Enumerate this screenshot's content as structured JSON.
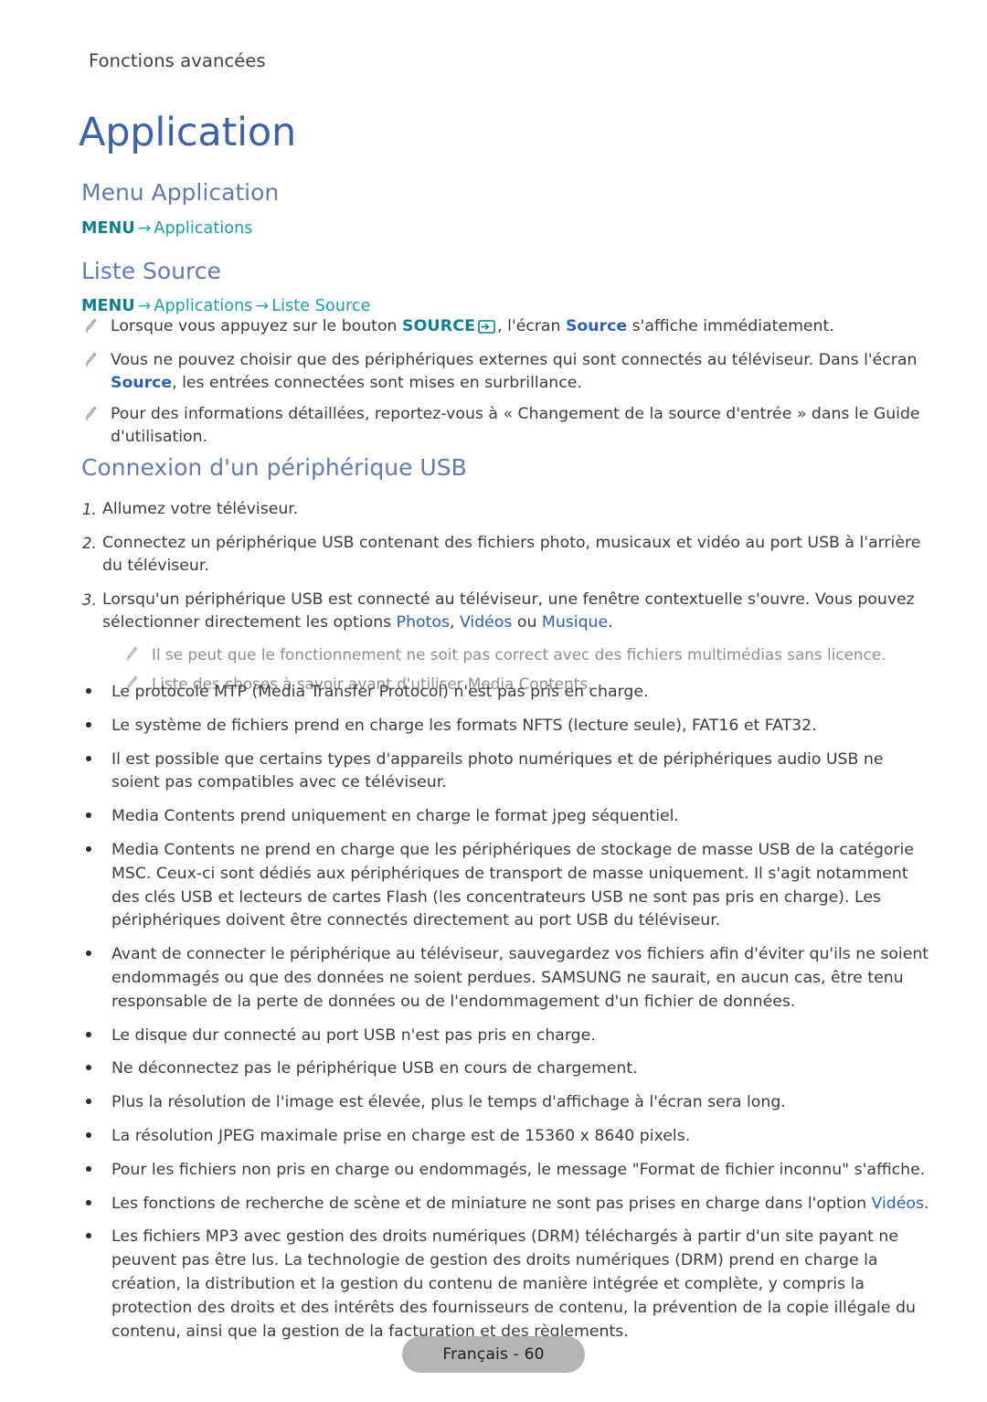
{
  "header": {
    "running_title": "Fonctions avancées"
  },
  "title": "Application",
  "sections": {
    "menu_application": {
      "heading": "Menu Application",
      "path": {
        "menu": "MENU",
        "arrow": "→",
        "item1": "Applications"
      }
    },
    "liste_source": {
      "heading": "Liste Source",
      "path": {
        "menu": "MENU",
        "arrow1": "→",
        "item1": "Applications",
        "arrow2": "→",
        "item2": "Liste Source"
      },
      "notes": [
        {
          "pre": "Lorsque vous appuyez sur le bouton ",
          "kw": "SOURCE",
          "icon": "source-button-icon",
          "mid": ", l'écran ",
          "link": "Source",
          "post": " s'affiche immédiatement."
        },
        {
          "pre": "Vous ne pouvez choisir que des périphériques externes qui sont connectés au téléviseur. Dans l'écran ",
          "link": "Source",
          "post": ", les entrées connectées sont mises en surbrillance."
        },
        {
          "pre": "Pour des informations détaillées, reportez-vous à « Changement de la source d'entrée » dans le Guide d'utilisation."
        }
      ]
    },
    "connexion_usb": {
      "heading": "Connexion d'un périphérique USB",
      "steps": [
        {
          "num": "1.",
          "text": "Allumez votre téléviseur."
        },
        {
          "num": "2.",
          "text": "Connectez un périphérique USB contenant des fichiers photo, musicaux et vidéo au port USB à l'arrière du téléviseur."
        },
        {
          "num": "3.",
          "pre": "Lorsqu'un périphérique USB est connecté au téléviseur, une fenêtre contextuelle s'ouvre. Vous pouvez sélectionner directement les options ",
          "link1": "Photos",
          "sep1": ", ",
          "link2": "Vidéos",
          "sep2": " ou ",
          "link3": "Musique",
          "post": ".",
          "subnotes": [
            "Il se peut que le fonctionnement ne soit pas correct avec des fichiers multimédias sans licence.",
            "Liste des choses à savoir avant d'utiliser Media Contents."
          ]
        }
      ],
      "bullets": [
        {
          "text": "Le protocole MTP (Media Transfer Protocol) n'est pas pris en charge."
        },
        {
          "text": "Le système de fichiers prend en charge les formats NFTS (lecture seule), FAT16 et FAT32."
        },
        {
          "text": "Il est possible que certains types d'appareils photo numériques et de périphériques audio USB ne soient pas compatibles avec ce téléviseur."
        },
        {
          "text": "Media Contents prend uniquement en charge le format jpeg séquentiel."
        },
        {
          "text": "Media Contents ne prend en charge que les périphériques de stockage de masse USB de la catégorie MSC. Ceux-ci sont dédiés aux périphériques de transport de masse uniquement. Il s'agit notamment des clés USB et lecteurs de cartes Flash (les concentrateurs USB ne sont pas pris en charge). Les périphériques doivent être connectés directement au port USB du téléviseur."
        },
        {
          "text": "Avant de connecter le périphérique au téléviseur, sauvegardez vos fichiers afin d'éviter qu'ils ne soient endommagés ou que des données ne soient perdues. SAMSUNG ne saurait, en aucun cas, être tenu responsable de la perte de données ou de l'endommagement d'un fichier de données."
        },
        {
          "text": "Le disque dur connecté au port USB n'est pas pris en charge."
        },
        {
          "text": "Ne déconnectez pas le périphérique USB en cours de chargement."
        },
        {
          "text": "Plus la résolution de l'image est élevée, plus le temps d'affichage à l'écran sera long."
        },
        {
          "text": "La résolution JPEG maximale prise en charge est de 15360 x 8640 pixels."
        },
        {
          "text": "Pour les fichiers non pris en charge ou endommagés, le message \"Format de fichier inconnu\" s'affiche."
        },
        {
          "pre": "Les fonctions de recherche de scène et de miniature ne sont pas prises en charge dans l'option ",
          "link": "Vidéos",
          "post": "."
        },
        {
          "text": "Les fichiers MP3 avec gestion des droits numériques (DRM) téléchargés à partir d'un site payant ne peuvent pas être lus. La technologie de gestion des droits numériques (DRM) prend en charge la création, la distribution et la gestion du contenu de manière intégrée et complète, y compris la protection des droits et des intérêts des fournisseurs de contenu, la prévention de la copie illégale du contenu, ainsi que la gestion de la facturation et des règlements."
        }
      ]
    }
  },
  "footer": {
    "page_label": "Français - 60"
  },
  "colors": {
    "title_blue": "#3e62a6",
    "subtitle_blue": "#6479ad",
    "menu_teal": "#0e7c8c",
    "menu_item_teal": "#2199ad",
    "link_blue": "#2f60ab",
    "body_text": "#3c3c3c",
    "dim_text": "#8e8e8e",
    "footer_pill": "#b5b5b5"
  }
}
